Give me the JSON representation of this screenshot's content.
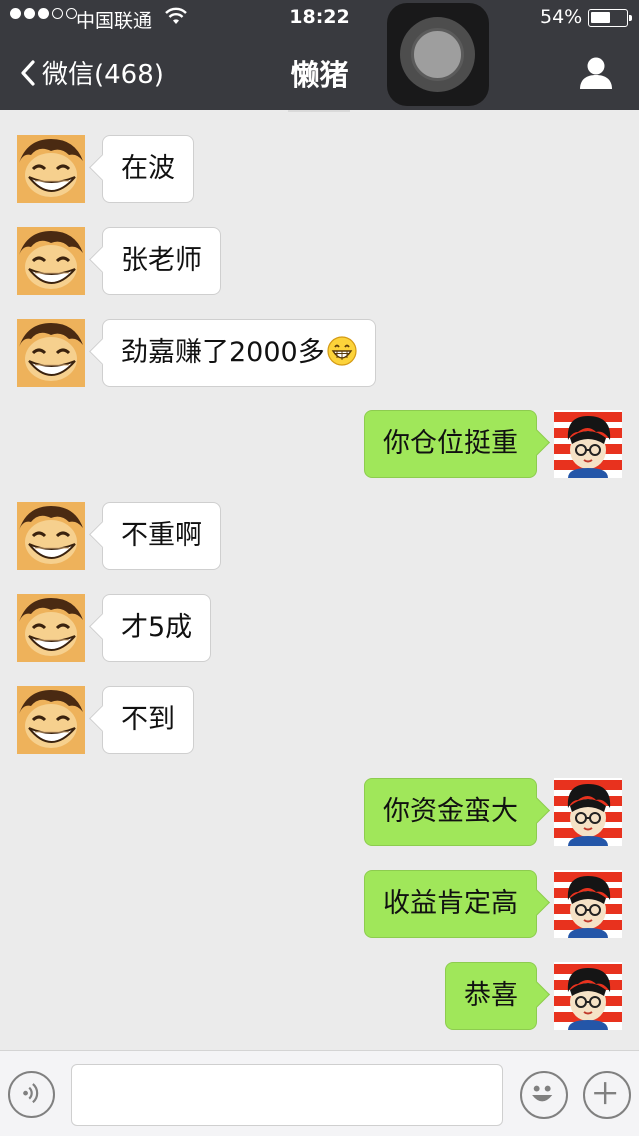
{
  "status_bar": {
    "carrier": "中国联通",
    "time": "18:22",
    "battery_percent": "54%",
    "battery_level": 0.54,
    "signal_bars_filled": 3,
    "signal_bars_total": 5
  },
  "nav": {
    "back_label": "微信(468)",
    "title": "懒猪"
  },
  "colors": {
    "nav_bg": "#393a3f",
    "chat_bg": "#ebebeb",
    "bubble_self": "#a0e75a",
    "bubble_other": "#ffffff"
  },
  "messages": [
    {
      "side": "left",
      "text": "在波"
    },
    {
      "side": "left",
      "text": "张老师"
    },
    {
      "side": "left",
      "text": "劲嘉赚了2000多",
      "emoji": "grinning-face"
    },
    {
      "side": "right",
      "text": "你仓位挺重"
    },
    {
      "side": "left",
      "text": "不重啊"
    },
    {
      "side": "left",
      "text": "才5成"
    },
    {
      "side": "left",
      "text": "不到"
    },
    {
      "side": "right",
      "text": "你资金蛮大"
    },
    {
      "side": "right",
      "text": "收益肯定高"
    },
    {
      "side": "right",
      "text": "恭喜"
    }
  ],
  "input_bar": {
    "icons": [
      "voice-icon",
      "emoji-icon",
      "plus-icon"
    ]
  }
}
